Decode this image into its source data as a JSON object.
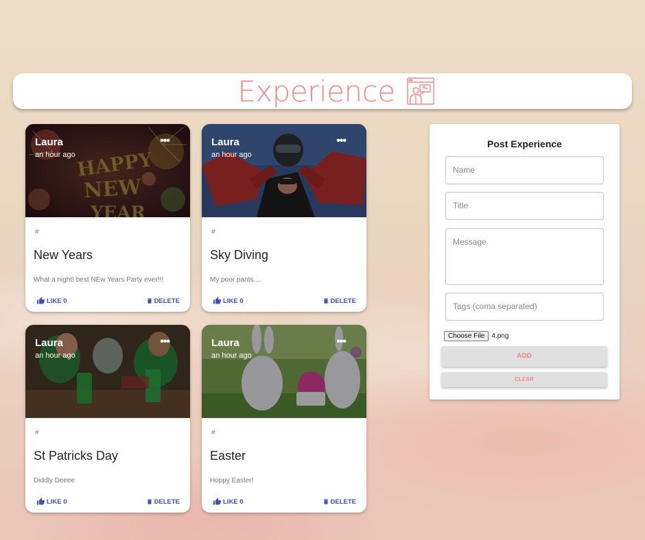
{
  "header": {
    "title": "Experience",
    "logo_icon": "presentation-icon",
    "accent": "#ee8a8c"
  },
  "posts": [
    {
      "author": "Laura",
      "time": "an hour ago",
      "tags": "#",
      "title": "New Years",
      "message": "What a night! best NEw Years Party ever!!!",
      "like_label": "LIKE 0",
      "delete_label": "DELETE"
    },
    {
      "author": "Laura",
      "time": "an hour ago",
      "tags": "#",
      "title": "Sky Diving",
      "message": "My poor pants....",
      "like_label": "LIKE 0",
      "delete_label": "DELETE"
    },
    {
      "author": "Laura",
      "time": "an hour ago",
      "tags": "#",
      "title": "St Patricks Day",
      "message": "Diddly Deeee",
      "like_label": "LIKE 0",
      "delete_label": "DELETE"
    },
    {
      "author": "Laura",
      "time": "an hour ago",
      "tags": "#",
      "title": "Easter",
      "message": "Hoppy Easter!",
      "like_label": "LIKE 0",
      "delete_label": "DELETE"
    }
  ],
  "form": {
    "title": "Post Experience",
    "name_placeholder": "Name",
    "title_placeholder": "Title",
    "message_placeholder": "Message",
    "tags_placeholder": "Tags (coma separated)",
    "file_button": "Choose File",
    "file_name": "4.png",
    "add_label": "ADD",
    "clear_label": "CLEAR"
  },
  "colors": {
    "primary_blue": "#3f51b5",
    "accent_pink": "#ee8a8c"
  }
}
